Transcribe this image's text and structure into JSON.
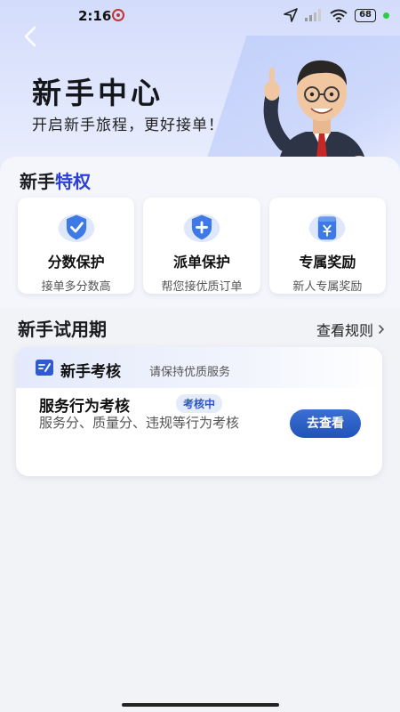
{
  "status_bar": {
    "time": "2:16",
    "battery": "68"
  },
  "hero": {
    "title": "新手中心",
    "subtitle": "开启新手旅程，更好接单！"
  },
  "privileges": {
    "title_prefix": "新手",
    "title_accent": "特权",
    "items": [
      {
        "icon": "shield-check-icon",
        "title": "分数保护",
        "desc": "接单多分数高"
      },
      {
        "icon": "shield-plus-icon",
        "title": "派单保护",
        "desc": "帮您接优质订单"
      },
      {
        "icon": "yuan-jar-icon",
        "title": "专属奖励",
        "desc": "新人专属奖励"
      }
    ]
  },
  "trial": {
    "title": "新手试用期",
    "rules_link": "查看规则",
    "exam": {
      "name": "新手考核",
      "hint": "请保持优质服务",
      "item_title": "服务行为考核",
      "badge": "考核中",
      "desc": "服务分、质量分、违规等行为考核",
      "button": "去查看"
    }
  },
  "colors": {
    "accent": "#2c3fd8",
    "button": "#2153b8",
    "badge_text": "#2c55c8"
  }
}
